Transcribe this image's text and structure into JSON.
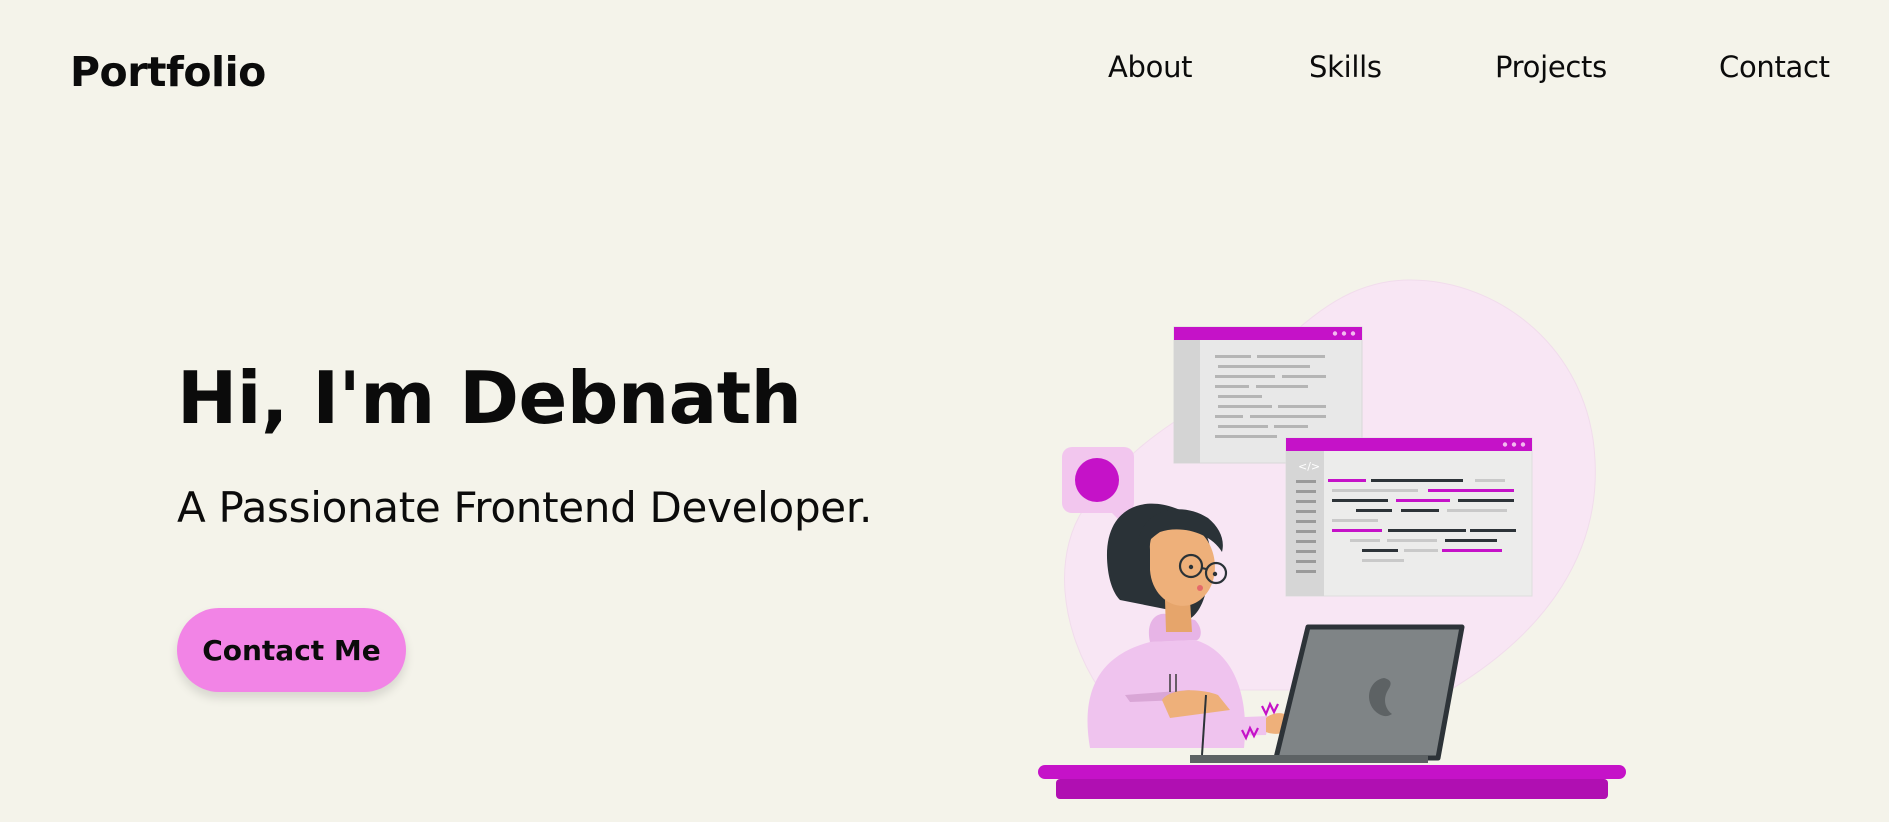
{
  "header": {
    "logo": "Portfolio",
    "nav": [
      "About",
      "Skills",
      "Projects",
      "Contact"
    ]
  },
  "hero": {
    "title": "Hi, I'm Debnath",
    "subtitle": "A Passionate Frontend Developer.",
    "cta_label": "Contact Me"
  },
  "colors": {
    "background": "#f4f3ea",
    "accent": "#c512c8",
    "button": "#f284e6",
    "text": "#0b0b0b"
  },
  "illustration": {
    "code_tag": "</>"
  }
}
